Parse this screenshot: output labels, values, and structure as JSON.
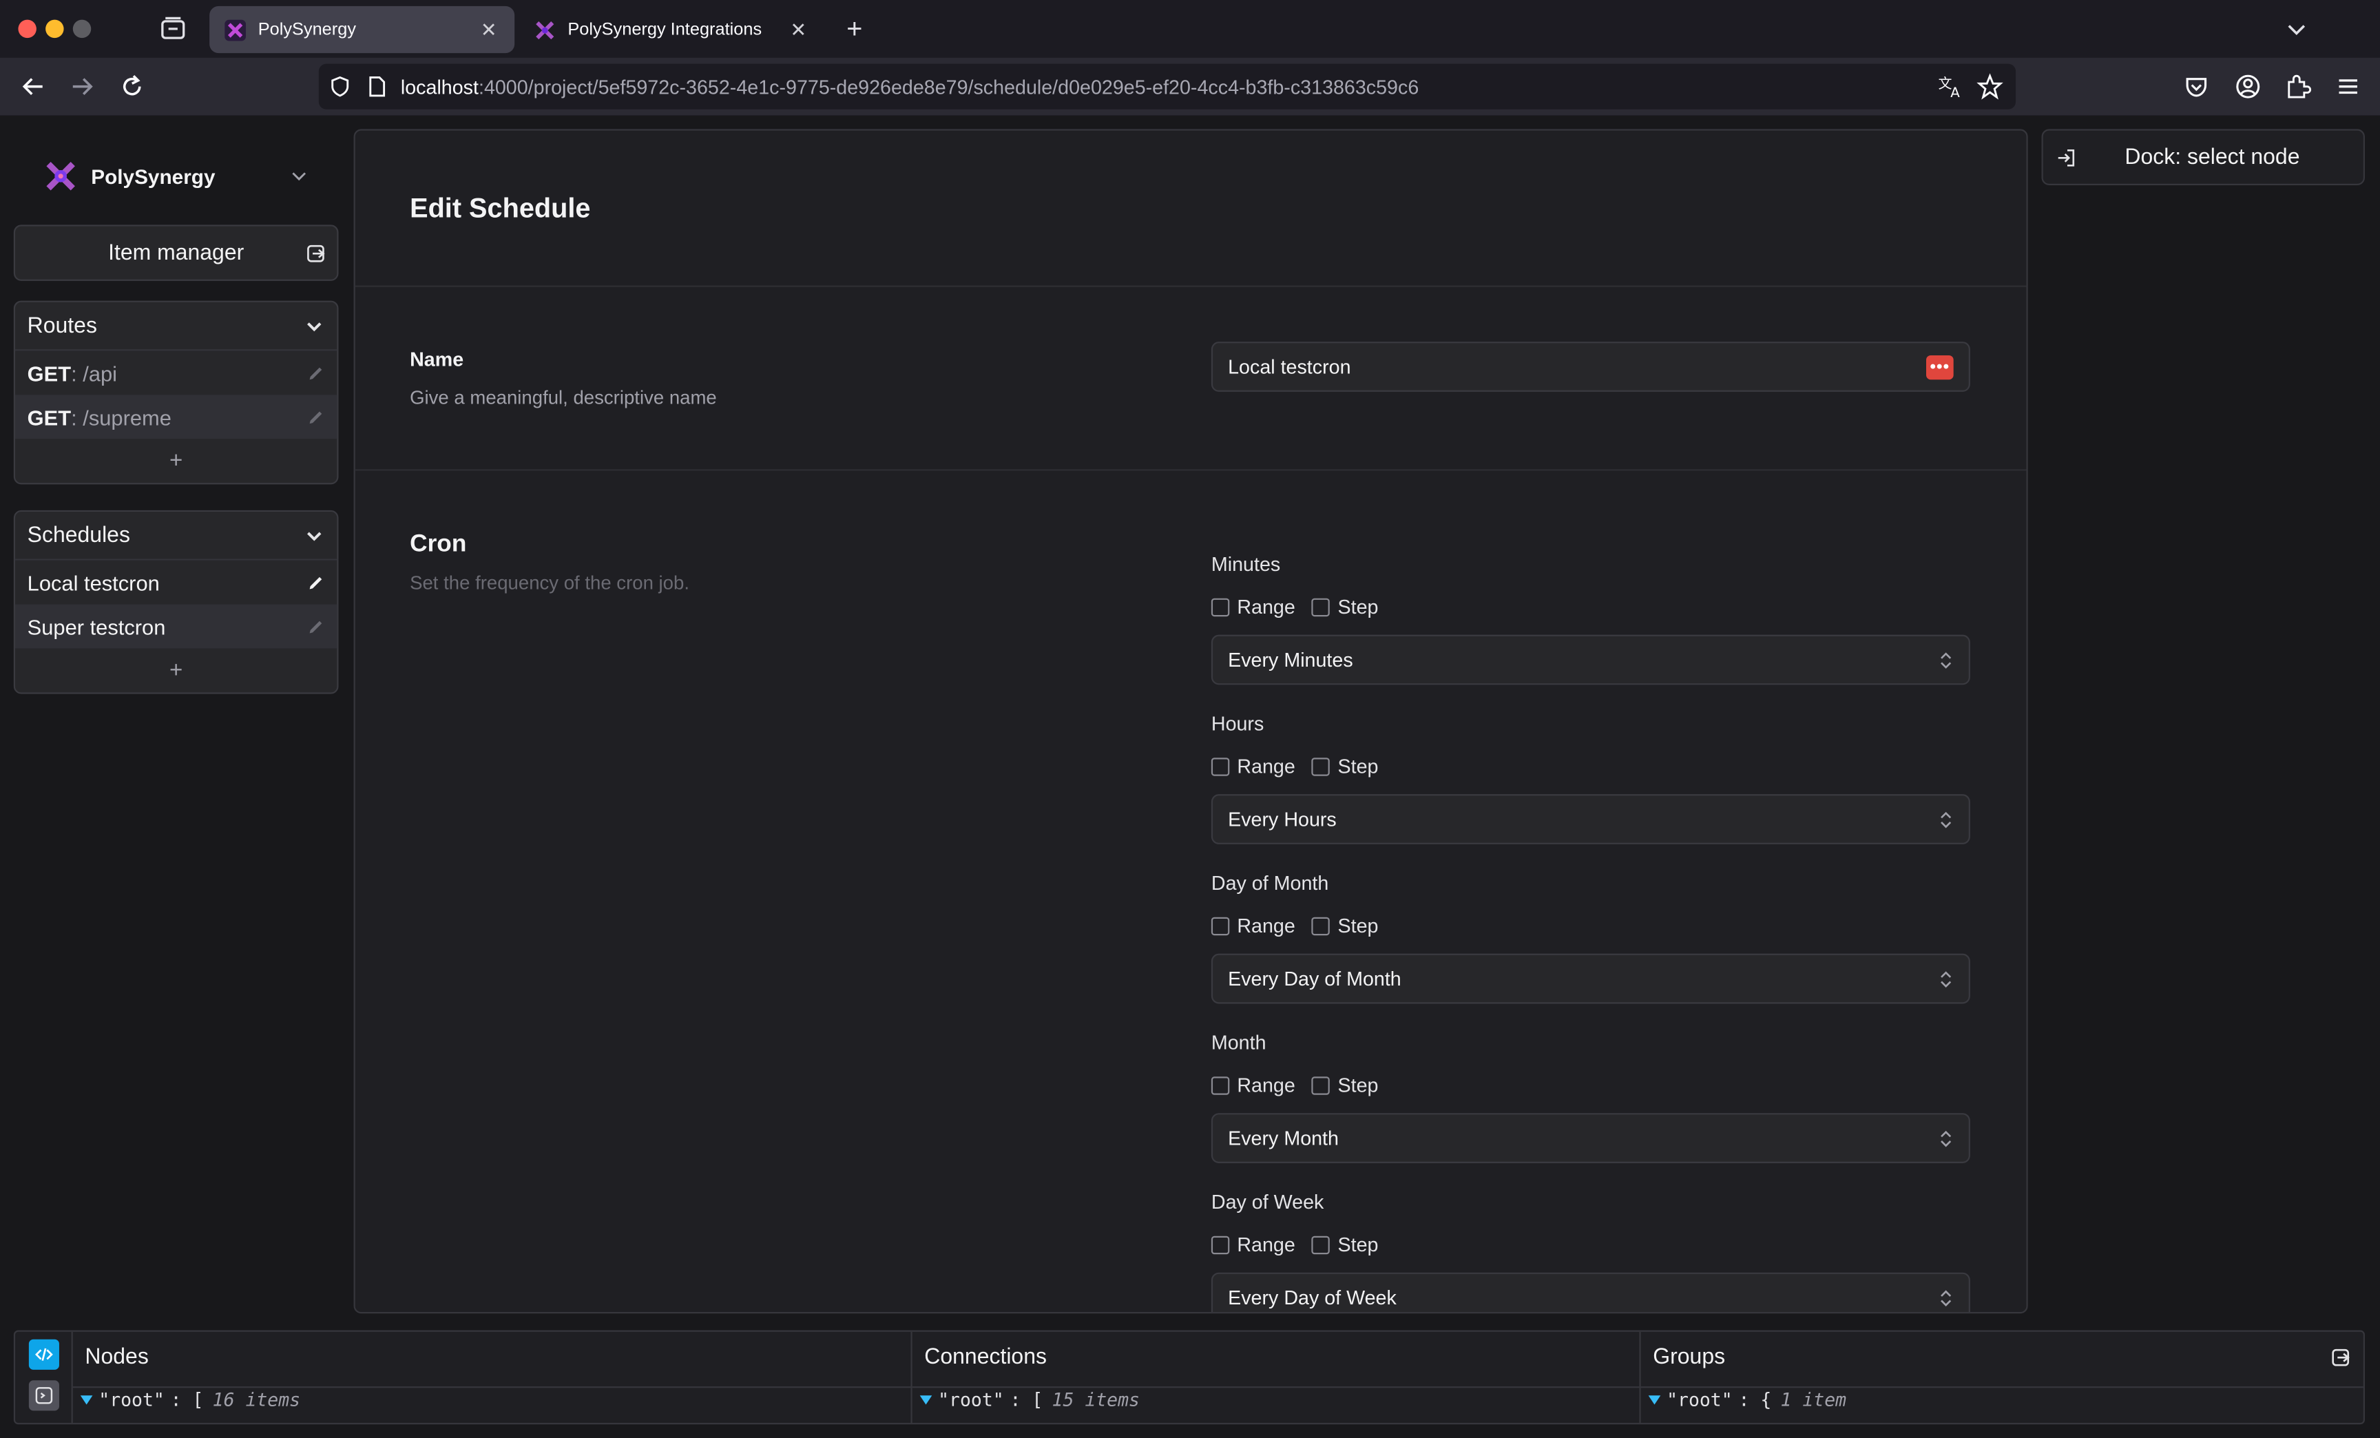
{
  "browser": {
    "tabs": [
      {
        "title": "PolySynergy",
        "active": true
      },
      {
        "title": "PolySynergy Integrations",
        "active": false
      }
    ],
    "url_host": "localhost",
    "url_path": ":4000/project/5ef5972c-3652-4e1c-9775-de926ede8e79/schedule/d0e029e5-ef20-4cc4-b3fb-c313863c59c6"
  },
  "sidebar": {
    "app_name": "PolySynergy",
    "item_manager": "Item manager",
    "routes": {
      "title": "Routes",
      "items": [
        {
          "method": "GET",
          "sep": ": ",
          "path": "/api"
        },
        {
          "method": "GET",
          "sep": ": ",
          "path": "/supreme"
        }
      ],
      "add": "+"
    },
    "schedules": {
      "title": "Schedules",
      "items": [
        {
          "label": "Local testcron"
        },
        {
          "label": "Super testcron"
        }
      ],
      "add": "+"
    }
  },
  "main": {
    "title": "Edit Schedule",
    "name_label": "Name",
    "name_desc": "Give a meaningful, descriptive name",
    "name_value": "Local testcron",
    "password_badge": "•••",
    "cron_title": "Cron",
    "cron_desc": "Set the frequency of the cron job.",
    "range_label": "Range",
    "step_label": "Step",
    "fields": [
      {
        "label": "Minutes",
        "value": "Every Minutes"
      },
      {
        "label": "Hours",
        "value": "Every Hours"
      },
      {
        "label": "Day of Month",
        "value": "Every Day of Month"
      },
      {
        "label": "Month",
        "value": "Every Month"
      },
      {
        "label": "Day of Week",
        "value": "Every Day of Week"
      }
    ]
  },
  "dock": {
    "label": "Dock: select node"
  },
  "bottom": {
    "columns": [
      {
        "title": "Nodes",
        "key": "\"root\"",
        "bracket": ": [",
        "count": "16 items"
      },
      {
        "title": "Connections",
        "key": "\"root\"",
        "bracket": ": [",
        "count": "15 items"
      },
      {
        "title": "Groups",
        "key": "\"root\"",
        "bracket": ": {",
        "count": "1 item"
      }
    ]
  },
  "colors": {
    "accent": "#0ea5e9",
    "danger": "#e0463d",
    "background": "#18181b"
  }
}
